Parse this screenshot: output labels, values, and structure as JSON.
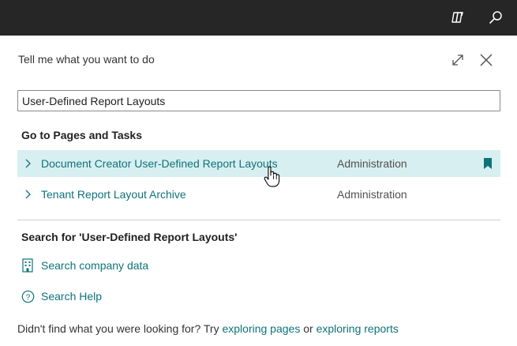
{
  "topbar": {
    "copilot_icon": "copilot-icon",
    "search_icon": "search-icon"
  },
  "dialog": {
    "title": "Tell me what you want to do",
    "search_value": "User-Defined Report Layouts"
  },
  "pages_section": {
    "heading": "Go to Pages and Tasks",
    "results": [
      {
        "name": "Document Creator User-Defined Report Layouts",
        "category": "Administration",
        "selected": true
      },
      {
        "name": "Tenant Report Layout Archive",
        "category": "Administration",
        "selected": false
      }
    ]
  },
  "search_section": {
    "heading": "Search for 'User-Defined Report Layouts'",
    "links": [
      {
        "label": "Search company data",
        "icon": "building-icon"
      },
      {
        "label": "Search Help",
        "icon": "help-circle-icon"
      }
    ]
  },
  "footer": {
    "prefix": "Didn't find what you were looking for? Try ",
    "link1": "exploring pages",
    "middle": " or ",
    "link2": "exploring reports"
  },
  "colors": {
    "topbar": "#262626",
    "accent": "#0e7379",
    "selected_row": "#d8eff1"
  }
}
